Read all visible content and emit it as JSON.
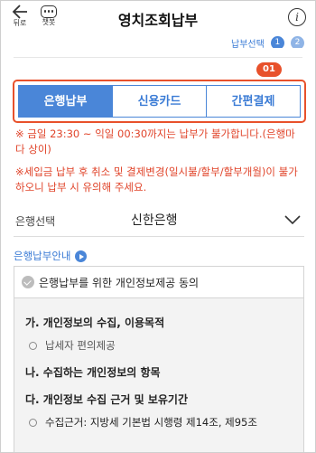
{
  "header": {
    "back_label": "뒤로",
    "chatbot_label": "챗봇",
    "title": "영치조회납부",
    "info_glyph": "i"
  },
  "steps": {
    "label": "납부선택",
    "items": [
      "1",
      "2"
    ]
  },
  "marker": "01",
  "tabs": [
    {
      "label": "은행납부",
      "active": true
    },
    {
      "label": "신용카드",
      "active": false
    },
    {
      "label": "간편결제",
      "active": false
    }
  ],
  "notices": [
    "※ 금일 23:30 ~ 익일 00:30까지는 납부가 불가합니다.(은행마다 상이)",
    "※세입금 납부 후 취소 및 결제변경(일시불/할부/할부개월)이 불가하오니 납부 시 유의해 주세요."
  ],
  "bank": {
    "label": "은행선택",
    "value": "신한은행"
  },
  "guide": {
    "label": "은행납부안내"
  },
  "consent": {
    "label": "은행납부를 위한 개인정보제공 동의",
    "sections": [
      {
        "heading": "가. 개인정보의 수집, 이용목적",
        "item": "납세자 편의제공"
      },
      {
        "heading": "나. 수집하는 개인정보의 항목",
        "item": ""
      },
      {
        "heading": "다. 개인정보 수집 근거 및 보유기간",
        "item": "수집근거: 지방세 기본법 시행령 제14조, 제95조"
      }
    ]
  },
  "colors": {
    "accent": "#4a86d8",
    "highlight": "#e8512b",
    "warning": "#e0442a"
  }
}
